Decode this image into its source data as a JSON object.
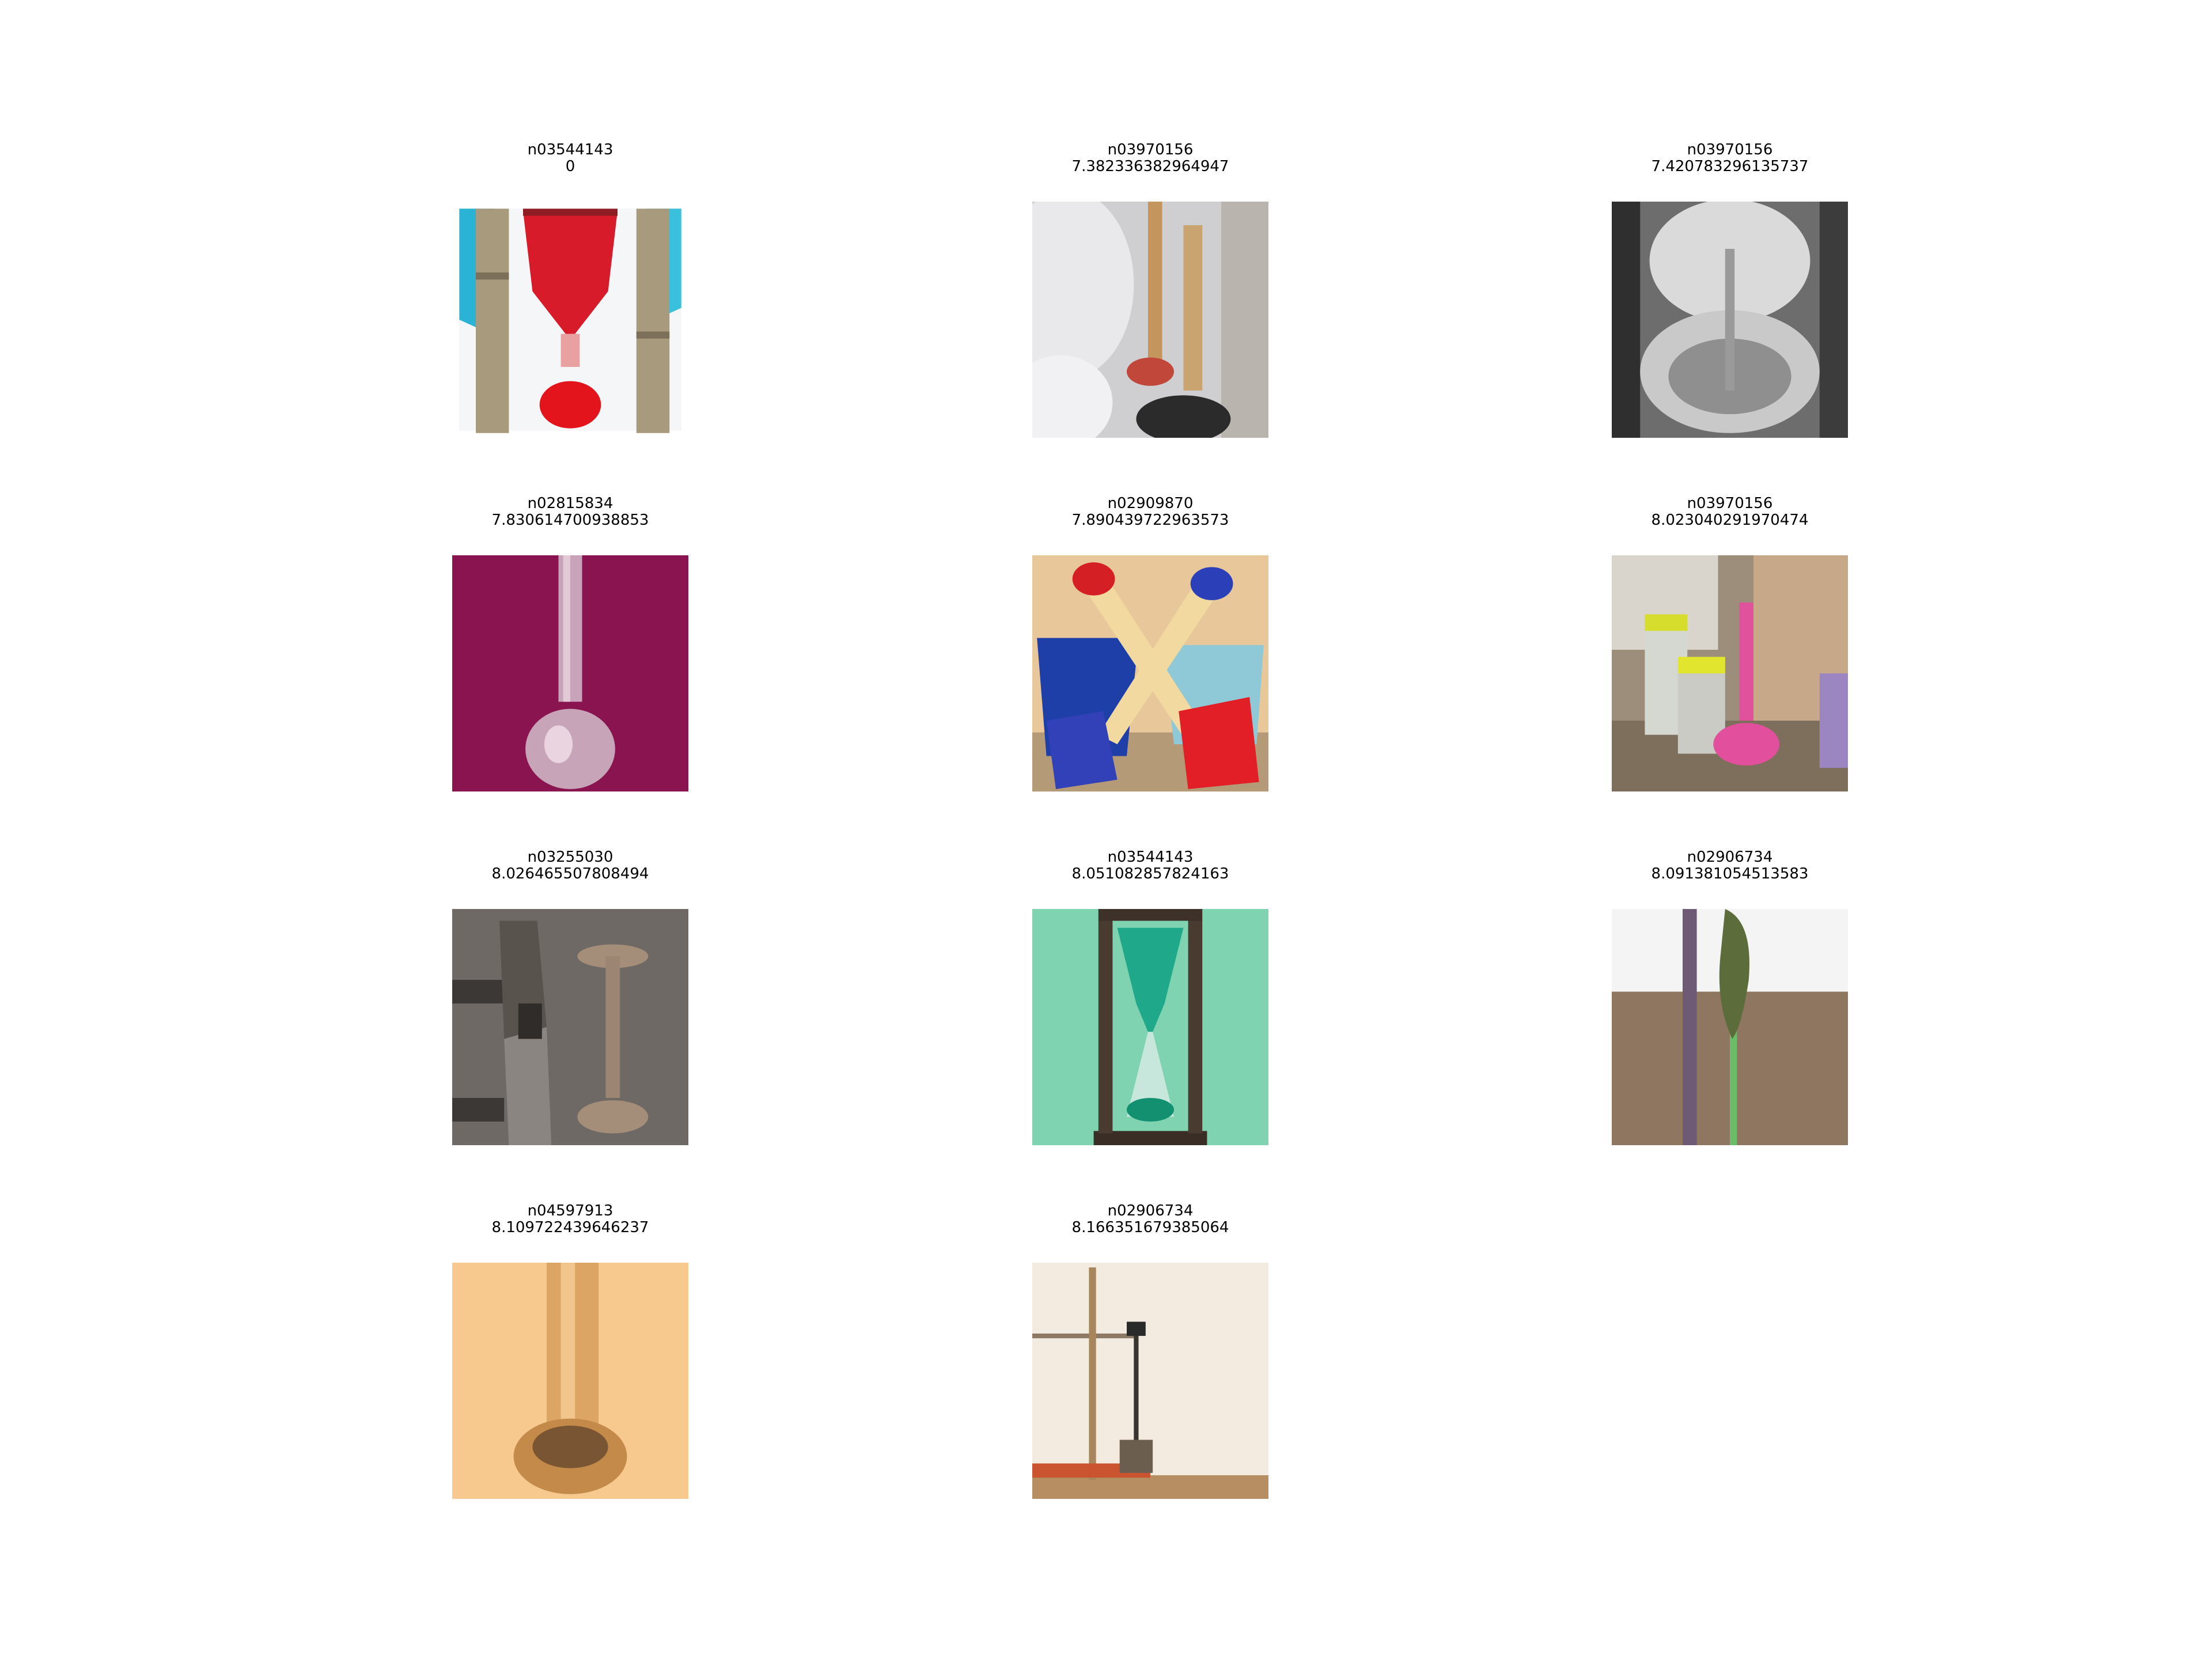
{
  "results": [
    {
      "label": "n03544143",
      "score": "0",
      "subject": "red hourglass between wooden posts"
    },
    {
      "label": "n03970156",
      "score": "7.382336382964947",
      "subject": "plunger beside toilet"
    },
    {
      "label": "n03970156",
      "score": "7.420783296135737",
      "subject": "plunger in toilet, grayscale"
    },
    {
      "label": "n02815834",
      "score": "7.830614700938853",
      "subject": "glass volumetric flask on magenta"
    },
    {
      "label": "n02909870",
      "score": "7.890439722963573",
      "subject": "toy buckets and spades"
    },
    {
      "label": "n03970156",
      "score": "8.023040291970474",
      "subject": "pink plunger among jars"
    },
    {
      "label": "n03255030",
      "score": "8.026465507808494",
      "subject": "iron dumbbells"
    },
    {
      "label": "n03544143",
      "score": "8.051082857824163",
      "subject": "teal hourglass"
    },
    {
      "label": "n02906734",
      "score": "8.091381054513583",
      "subject": "broom against wall"
    },
    {
      "label": "n04597913",
      "score": "8.109722439646237",
      "subject": "wooden spoon close-up"
    },
    {
      "label": "n02906734",
      "score": "8.166351679385064",
      "subject": "broom and shovel"
    }
  ]
}
